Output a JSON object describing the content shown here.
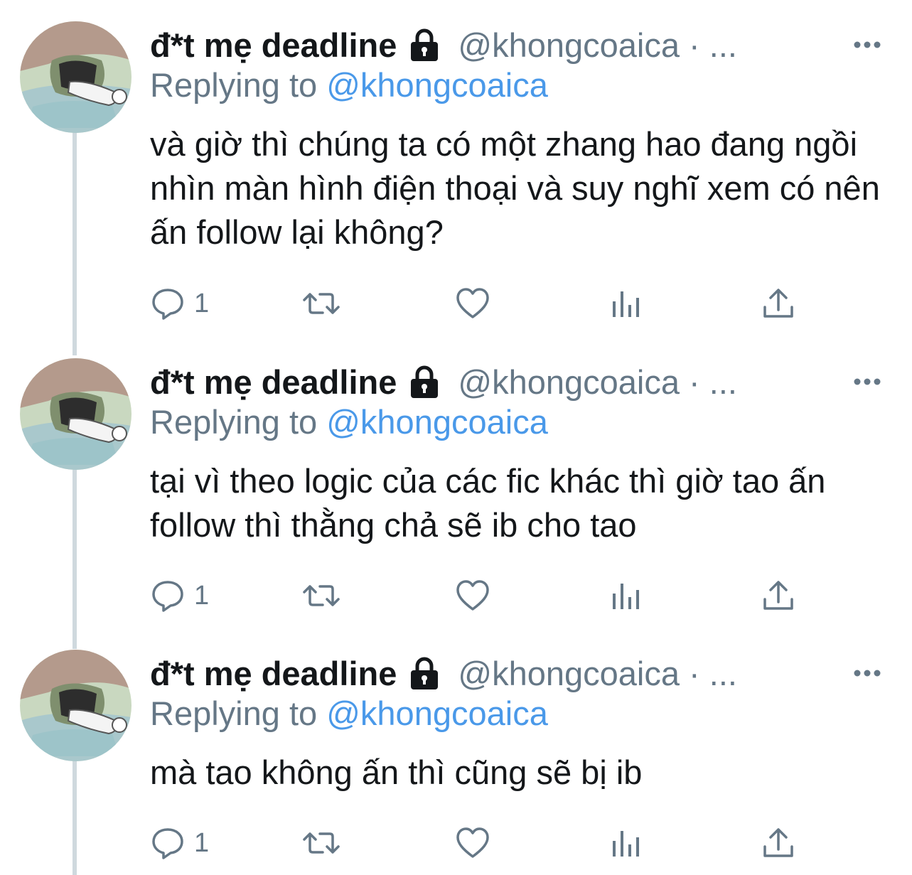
{
  "tweets": [
    {
      "display_name": "đ*t mẹ deadline",
      "handle": "@khongcoaica · ...",
      "replying_prefix": "Replying to ",
      "replying_handle": "@khongcoaica",
      "text": "và giờ thì chúng ta có một zhang hao đang ngồi nhìn màn hình điện thoại và suy nghĩ xem có nên ấn follow lại không?",
      "reply_count": "1",
      "icons": [
        "lock-icon",
        "more-icon",
        "reply-icon",
        "retweet-icon",
        "like-icon",
        "analytics-icon",
        "share-icon"
      ]
    },
    {
      "display_name": "đ*t mẹ deadline",
      "handle": "@khongcoaica · ...",
      "replying_prefix": "Replying to ",
      "replying_handle": "@khongcoaica",
      "text": "tại vì theo logic của các fic khác thì giờ tao ấn follow thì thằng chả sẽ ib cho tao",
      "reply_count": "1",
      "icons": [
        "lock-icon",
        "more-icon",
        "reply-icon",
        "retweet-icon",
        "like-icon",
        "analytics-icon",
        "share-icon"
      ]
    },
    {
      "display_name": "đ*t mẹ deadline",
      "handle": "@khongcoaica · ...",
      "replying_prefix": "Replying to ",
      "replying_handle": "@khongcoaica",
      "text": "mà tao không ấn thì cũng sẽ bị ib",
      "reply_count": "1",
      "icons": [
        "lock-icon",
        "more-icon",
        "reply-icon",
        "retweet-icon",
        "like-icon",
        "analytics-icon",
        "share-icon"
      ]
    }
  ],
  "colors": {
    "text": "#14171a",
    "secondary": "#657786",
    "link": "#4a99e9",
    "thread_line": "#cfd9de",
    "icon": "#657786"
  }
}
